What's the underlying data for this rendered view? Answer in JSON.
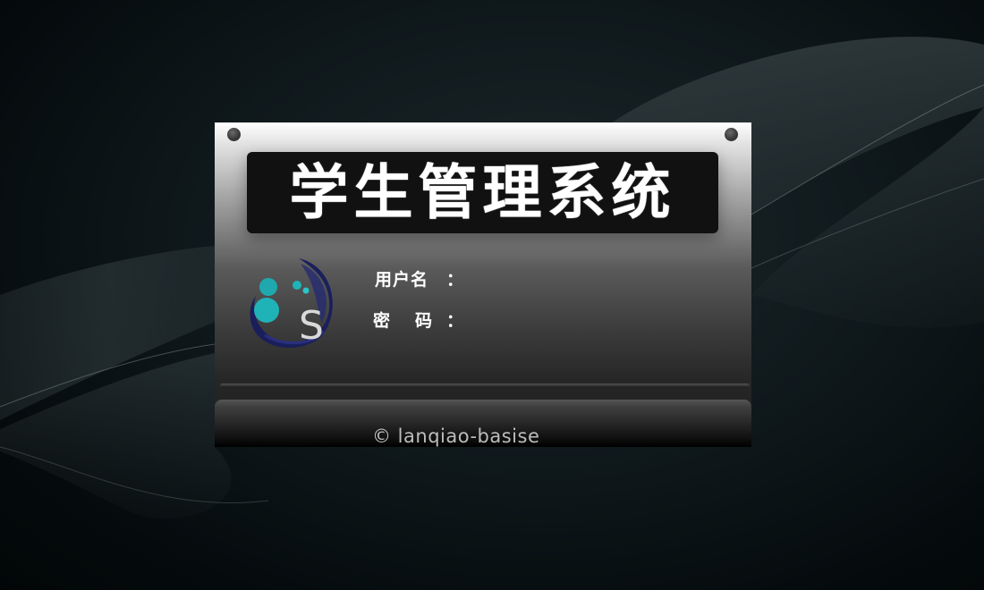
{
  "app": {
    "title": "学生管理系统"
  },
  "form": {
    "username_label": "用户名",
    "password_label": "密码",
    "colon": "：",
    "username_value": "",
    "password_value": ""
  },
  "logo": {
    "letter": "S",
    "name": "logo-icon"
  },
  "footer": {
    "copyright": "© lanqiao-basise"
  },
  "colors": {
    "accent_teal": "#1fb3b8",
    "logo_navy": "#1a1f5c",
    "title_bg": "#111111"
  }
}
